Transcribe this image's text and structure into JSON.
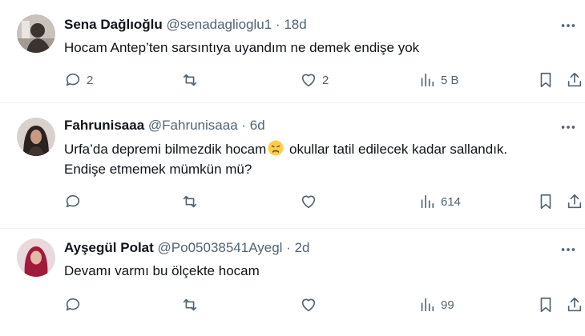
{
  "tweets": [
    {
      "name": "Sena Dağlıoğlu",
      "handle": "@senadaglioglu1",
      "sep": "·",
      "time": "18d",
      "text": "Hocam Antep’ten sarsıntıya uyandım ne demek endişe yok",
      "replies": "2",
      "retweets": "",
      "likes": "2",
      "views": "5 B",
      "avatar_icon": "avatar-photo",
      "colors": {
        "avatar_bg": "#c9c2bb",
        "avatar_fg": "#3b3330"
      }
    },
    {
      "name": "Fahrunisaaa",
      "handle": "@Fahrunisaaa",
      "sep": "·",
      "time": "6d",
      "text_a": "Urfa’da depremi bilmezdik hocam",
      "text_b": " okullar tatil edilecek kadar sallandık.",
      "text_c": "Endişe etmemek mümkün mü?",
      "emoji": "disappointed-face-emoji",
      "replies": "",
      "retweets": "",
      "likes": "",
      "views": "614",
      "avatar_icon": "avatar-photo",
      "colors": {
        "avatar_bg": "#d8d1cc",
        "avatar_fg": "#2a2220"
      }
    },
    {
      "name": "Ayşegül Polat",
      "handle": "@Po05038541Ayegl",
      "sep": "·",
      "time": "2d",
      "text": "Devamı varmı bu ölçekte hocam",
      "replies": "",
      "retweets": "",
      "likes": "",
      "views": "99",
      "avatar_icon": "avatar-photo",
      "colors": {
        "avatar_bg": "#e7d9dc",
        "avatar_fg": "#a01a3b"
      }
    }
  ],
  "icons": {
    "reply": "reply-bubble-icon",
    "retweet": "retweet-arrows-icon",
    "like": "heart-icon",
    "views": "views-bar-chart-icon",
    "bookmark": "bookmark-icon",
    "share": "share-upload-icon",
    "more": "more-dots-icon"
  },
  "theme": {
    "text": "#0f1419",
    "muted": "#536471",
    "divider": "#eff3f4"
  }
}
